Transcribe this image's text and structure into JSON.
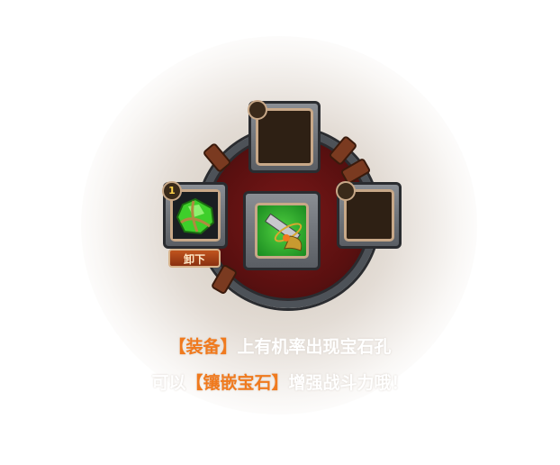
{
  "slots": {
    "left_count": "1",
    "unload_label": "卸下"
  },
  "hint": {
    "line1": {
      "highlight": "【装备】",
      "rest": "上有机率出现宝石孔"
    },
    "line2": {
      "prefix": "可以",
      "highlight": "【镶嵌宝石】",
      "rest": "增强战斗力哦！"
    }
  },
  "colors": {
    "highlight": "#f07a1e",
    "gem": "#3ecf2a"
  }
}
